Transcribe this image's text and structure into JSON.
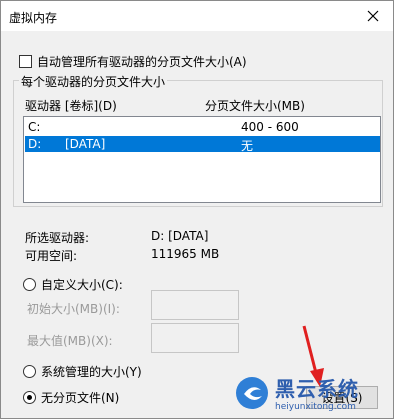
{
  "window": {
    "title": "虚拟内存"
  },
  "auto_manage": {
    "label": "自动管理所有驱动器的分页文件大小(A)",
    "checked": false
  },
  "group": {
    "legend": "每个驱动器的分页文件大小",
    "col_drive": "驱动器 [卷标](D)",
    "col_size": "分页文件大小(MB)",
    "rows": [
      {
        "drive": "C:",
        "label": "",
        "size": "400 - 600",
        "selected": false
      },
      {
        "drive": "D:",
        "label": "[DATA]",
        "size": "无",
        "selected": true
      }
    ]
  },
  "details": {
    "selected_drive_label": "所选驱动器:",
    "selected_drive_value": "D:  [DATA]",
    "free_space_label": "可用空间:",
    "free_space_value": "111965 MB"
  },
  "options": {
    "custom_size": "自定义大小(C):",
    "initial_size": "初始大小(MB)(I):",
    "max_size": "最大值(MB)(X):",
    "system_managed": "系统管理的大小(Y)",
    "no_paging": "无分页文件(N)",
    "selected": "no_paging"
  },
  "buttons": {
    "set": "设置(S)"
  },
  "watermark": {
    "brand": "黑云系统",
    "site": "heiyunxitong.com"
  },
  "colors": {
    "selection": "#0078d7",
    "arrow": "#e02020",
    "watermark": "#2f5fae"
  }
}
